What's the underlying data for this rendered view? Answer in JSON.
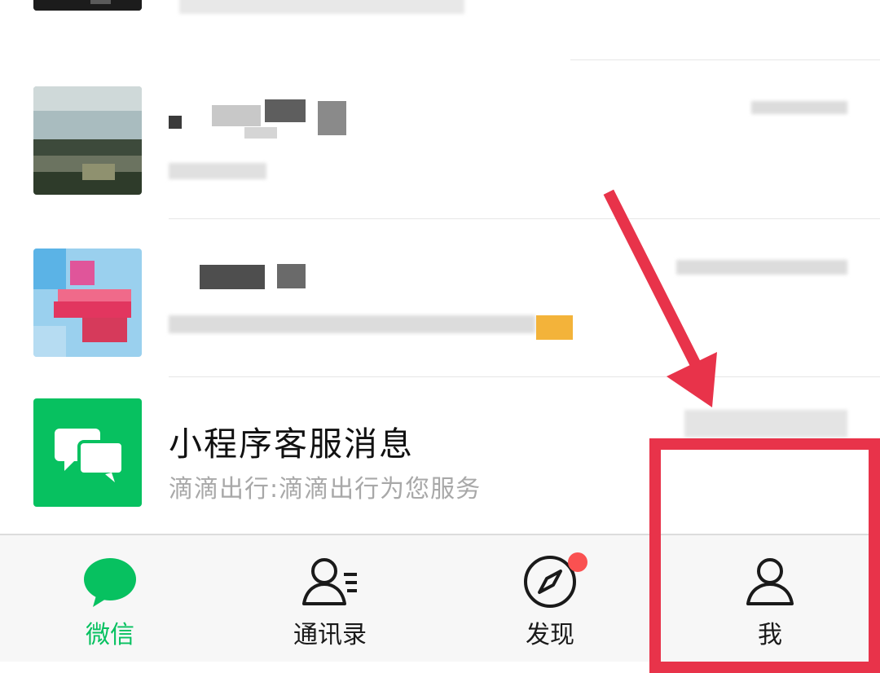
{
  "chat_list": {
    "rows": [
      {
        "title": "",
        "subtitle": "",
        "time": ""
      },
      {
        "title": "",
        "subtitle": "",
        "time": ""
      },
      {
        "title": "",
        "subtitle": "",
        "time": ""
      },
      {
        "title": "小程序客服消息",
        "subtitle": "滴滴出行:滴滴出行为您服务",
        "time": "",
        "icon": "chat-bubbles-icon"
      }
    ]
  },
  "tabbar": {
    "tabs": [
      {
        "label": "微信",
        "icon": "chat-icon",
        "active": true
      },
      {
        "label": "通讯录",
        "icon": "contacts-icon",
        "active": false
      },
      {
        "label": "发现",
        "icon": "compass-icon",
        "active": false,
        "badge": "red-dot"
      },
      {
        "label": "我",
        "icon": "person-icon",
        "active": false
      }
    ]
  },
  "colors": {
    "accent_green": "#07c160",
    "annotation_red": "#e8334a",
    "badge_red": "#fa5151"
  }
}
